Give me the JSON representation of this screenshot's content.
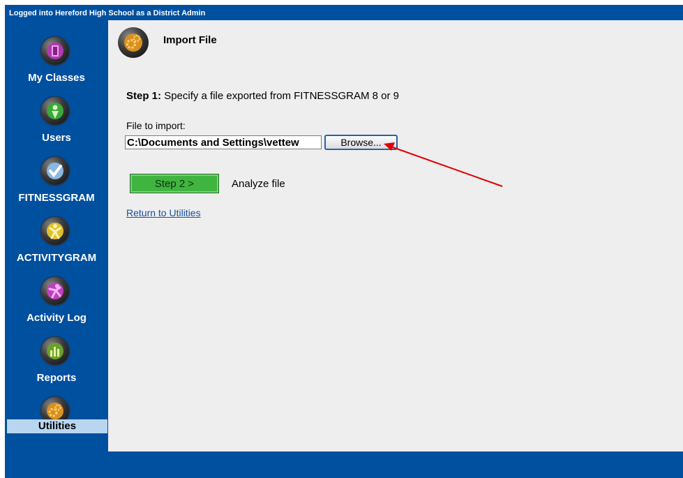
{
  "header": {
    "login_text": "Logged into Hereford High School as a District Admin"
  },
  "sidebar": {
    "items": [
      {
        "label": "My Classes"
      },
      {
        "label": "Users"
      },
      {
        "label": "FITNESSGRAM"
      },
      {
        "label": "ACTIVITYGRAM"
      },
      {
        "label": "Activity Log"
      },
      {
        "label": "Reports"
      },
      {
        "label": "Utilities"
      }
    ],
    "selected": "Utilities"
  },
  "main": {
    "title": "Import File",
    "step1_label": "Step 1:",
    "step1_text": "Specify a file exported from FITNESSGRAM 8 or 9",
    "file_label": "File to import:",
    "file_value": "C:\\Documents and Settings\\vettew",
    "browse_label": "Browse...",
    "step2_label": "Step 2 >",
    "analyze_label": "Analyze file",
    "return_link": "Return to Utilities"
  },
  "colors": {
    "frame": "#0050a0",
    "content_bg": "#eeeeee",
    "step2_button": "#3fb53f",
    "selected_item": "#b9d6f0",
    "annotation_arrow": "#e00000"
  }
}
